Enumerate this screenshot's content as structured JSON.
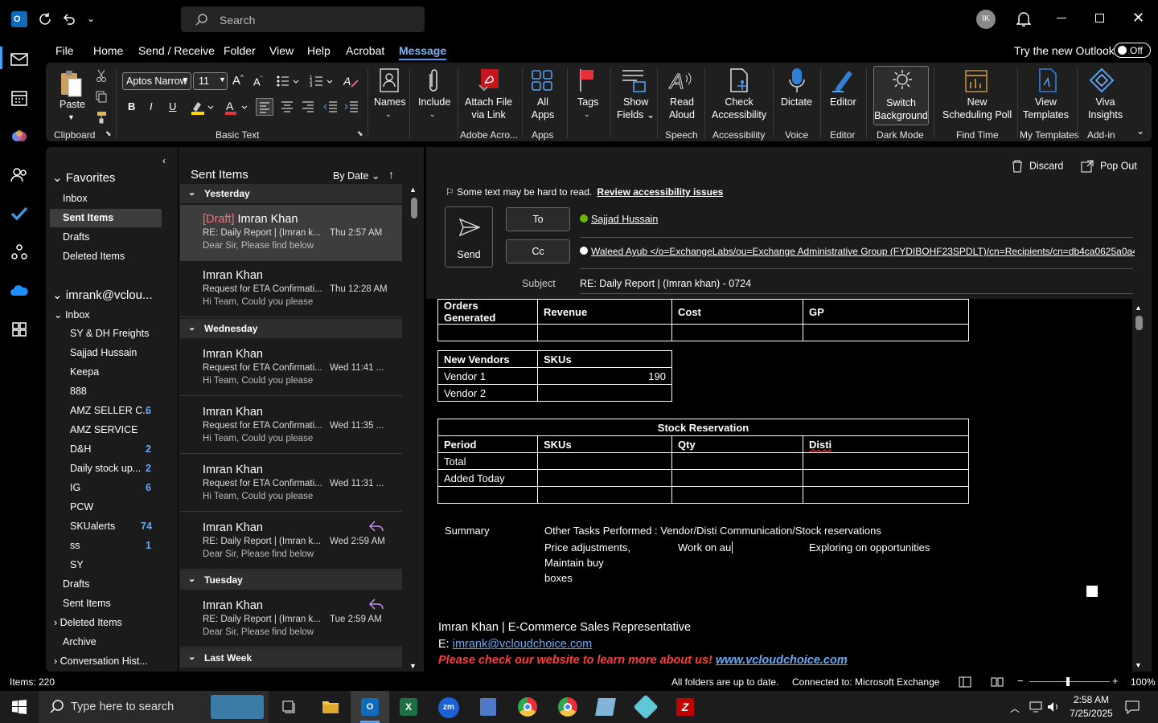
{
  "titlebar": {
    "search_placeholder": "Search",
    "avatar_initials": "IK",
    "app": "outlook"
  },
  "menu_tabs": [
    "File",
    "Home",
    "Send / Receive",
    "Folder",
    "View",
    "Help",
    "Acrobat",
    "Message"
  ],
  "active_tab": "Message",
  "new_outlook": {
    "label": "Try the new Outlook",
    "toggle": "Off"
  },
  "ribbon": {
    "paste": "Paste",
    "font_name": "Aptos Narrow",
    "font_size": "11",
    "groups": {
      "clipboard": "Clipboard",
      "basic_text": "Basic Text",
      "adobe": "Adobe Acro...",
      "apps": "Apps",
      "speech": "Speech",
      "accessibility": "Accessibility",
      "voice": "Voice",
      "editor": "Editor",
      "dark_mode": "Dark Mode",
      "find_time": "Find Time",
      "my_templates": "My Templates",
      "addin": "Add-in"
    },
    "names": "Names",
    "include": "Include",
    "attach_file_1": "Attach File",
    "attach_file_2": "via Link",
    "all_apps_1": "All",
    "all_apps_2": "Apps",
    "tags": "Tags",
    "show_fields_1": "Show",
    "show_fields_2": "Fields",
    "read_aloud_1": "Read",
    "read_aloud_2": "Aloud",
    "check_acc_1": "Check",
    "check_acc_2": "Accessibility",
    "dictate": "Dictate",
    "editor": "Editor",
    "switch_bg_1": "Switch",
    "switch_bg_2": "Background",
    "new_poll_1": "New",
    "new_poll_2": "Scheduling Poll",
    "view_templates_1": "View",
    "view_templates_2": "Templates",
    "viva_1": "Viva",
    "viva_2": "Insights"
  },
  "folders": {
    "favorites": "Favorites",
    "fav_items": [
      "Inbox",
      "Sent Items",
      "Drafts",
      "Deleted Items"
    ],
    "account": "imrank@vclou...",
    "inbox": "Inbox",
    "inbox_items": [
      {
        "label": "SY & DH Freights",
        "count": ""
      },
      {
        "label": "Sajjad Hussain",
        "count": ""
      },
      {
        "label": "Keepa",
        "count": ""
      },
      {
        "label": "888",
        "count": ""
      },
      {
        "label": "AMZ SELLER C...",
        "count": "6"
      },
      {
        "label": "AMZ SERVICE",
        "count": ""
      },
      {
        "label": "D&H",
        "count": "2"
      },
      {
        "label": "Daily stock up...",
        "count": "2"
      },
      {
        "label": "IG",
        "count": "6"
      },
      {
        "label": "PCW",
        "count": ""
      },
      {
        "label": "SKUalerts",
        "count": "74"
      },
      {
        "label": "ss",
        "count": "1"
      },
      {
        "label": "SY",
        "count": ""
      }
    ],
    "other_items": [
      "Drafts",
      "Sent Items",
      "Deleted Items",
      "Archive",
      "Conversation Hist..."
    ]
  },
  "msglist": {
    "title": "Sent Items",
    "sort": "By Date",
    "groups": [
      "Yesterday",
      "Wednesday",
      "Tuesday",
      "Last Week"
    ],
    "messages": [
      {
        "draft": "[Draft]",
        "from": "Imran Khan",
        "subject": "RE: Daily Report | (Imran k...",
        "date": "Thu 2:57 AM",
        "preview": "Dear Sir,  Please find below"
      },
      {
        "draft": "",
        "from": "Imran Khan",
        "subject": "Request for ETA Confirmati...",
        "date": "Thu 12:28 AM",
        "preview": "Hi Team,  Could you please"
      },
      {
        "draft": "",
        "from": "Imran Khan",
        "subject": "Request for ETA Confirmati...",
        "date": "Wed 11:41 ...",
        "preview": "Hi Team,  Could you please"
      },
      {
        "draft": "",
        "from": "Imran Khan",
        "subject": "Request for ETA Confirmati...",
        "date": "Wed 11:35 ...",
        "preview": "Hi Team,  Could you please"
      },
      {
        "draft": "",
        "from": "Imran Khan",
        "subject": "Request for ETA Confirmati...",
        "date": "Wed 11:31 ...",
        "preview": "Hi Team,  Could you please"
      },
      {
        "draft": "",
        "from": "Imran Khan",
        "subject": "RE: Daily Report | (Imran k...",
        "date": "Wed 2:59 AM",
        "preview": "Dear Sir,  Please find below"
      },
      {
        "draft": "",
        "from": "Imran Khan",
        "subject": "RE: Daily Report | (Imran k...",
        "date": "Tue 2:59 AM",
        "preview": "Dear Sir,  Please find below"
      }
    ]
  },
  "compose": {
    "discard": "Discard",
    "popout": "Pop Out",
    "acc_warning": "Some text may be hard to read.",
    "acc_link": "Review accessibility issues",
    "send": "Send",
    "to_btn": "To",
    "cc_btn": "Cc",
    "to_value": "Sajjad Hussain",
    "cc_value": "Waleed Ayub </o=ExchangeLabs/ou=Exchange Administrative Group (FYDIBOHF23SPDLT)/cn=Recipients/cn=db4ca0625a0a40",
    "subject_label": "Subject",
    "subject_value": "RE:  Daily Report | (Imran khan) - 0724"
  },
  "body": {
    "t1_headers": [
      "Orders Generated",
      "Revenue",
      "Cost",
      "GP"
    ],
    "t2_headers": [
      "New Vendors",
      "SKUs"
    ],
    "t2_rows": [
      [
        "Vendor 1",
        "190"
      ],
      [
        "Vendor 2",
        ""
      ]
    ],
    "t3_title": "Stock Reservation",
    "t3_headers": [
      "Period",
      "SKUs",
      "Qty",
      "Disti"
    ],
    "t3_rows": [
      "Total",
      "Added Today",
      ""
    ],
    "summary_label": "Summary",
    "other_tasks": "Other Tasks Performed :  Vendor/Disti Communication/Stock reservations",
    "task1": "Price adjustments,",
    "task2": "Work on au",
    "task3": "Exploring on opportunities",
    "task4": "Maintain buy",
    "task5": "boxes",
    "sig_name": "Imran Khan | E-Commerce Sales Representative",
    "sig_email_label": "E: ",
    "sig_email": "imrank@vcloudchoice.com",
    "sig_promo": "Please check our website to learn more about us!",
    "sig_site": "www.vcloudchoice.com"
  },
  "status": {
    "items": "Items: 220",
    "sync": "All folders are up to date.",
    "connection": "Connected to: Microsoft Exchange",
    "zoom": "100%"
  },
  "taskbar": {
    "search": "Type here to search",
    "time": "2:58 AM",
    "date": "7/25/2025"
  },
  "colors": {
    "accent": "#479ef5",
    "draft": "#f1707b",
    "badge": "#6aa9f4",
    "promo": "#ff3b3b",
    "link": "#6aa9f4"
  }
}
